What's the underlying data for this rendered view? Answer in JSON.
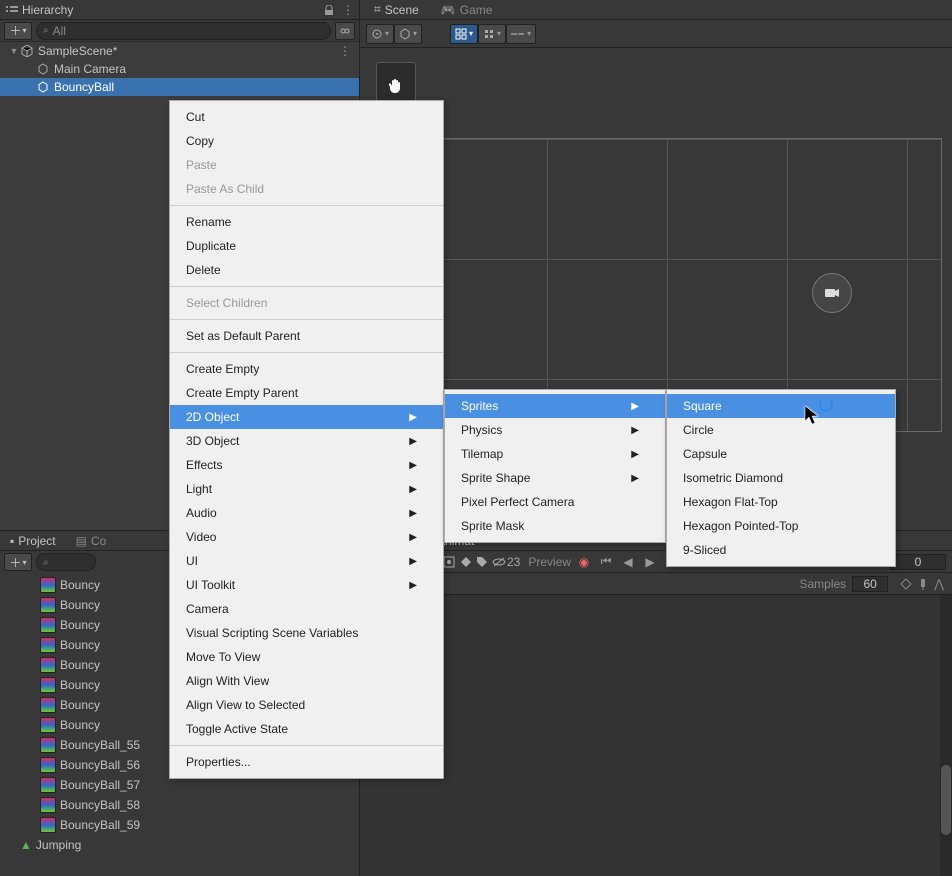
{
  "hierarchy": {
    "title": "Hierarchy",
    "search_placeholder": "All",
    "scene": "SampleScene*",
    "items": [
      "Main Camera",
      "BouncyBall"
    ]
  },
  "scene": {
    "tab_scene": "Scene",
    "tab_game": "Game"
  },
  "project": {
    "tab_project": "Project",
    "tab_console": "Co",
    "items": [
      "Bouncy",
      "Bouncy",
      "Bouncy",
      "Bouncy",
      "Bouncy",
      "Bouncy",
      "Bouncy",
      "Bouncy",
      "BouncyBall_55",
      "BouncyBall_56",
      "BouncyBall_57",
      "BouncyBall_58",
      "BouncyBall_59"
    ],
    "anim_clip": "Jumping"
  },
  "anim": {
    "tab": "Animat",
    "preview": "Preview",
    "frame": "0",
    "samples_label": "Samples",
    "samples_value": "60",
    "visibility_count": "23"
  },
  "menu": {
    "main": [
      {
        "label": "Cut"
      },
      {
        "label": "Copy"
      },
      {
        "label": "Paste",
        "disabled": true
      },
      {
        "label": "Paste As Child",
        "disabled": true
      },
      {
        "sep": true
      },
      {
        "label": "Rename"
      },
      {
        "label": "Duplicate"
      },
      {
        "label": "Delete"
      },
      {
        "sep": true
      },
      {
        "label": "Select Children",
        "disabled": true
      },
      {
        "sep": true
      },
      {
        "label": "Set as Default Parent"
      },
      {
        "sep": true
      },
      {
        "label": "Create Empty"
      },
      {
        "label": "Create Empty Parent"
      },
      {
        "label": "2D Object",
        "sub": true,
        "highlight": true
      },
      {
        "label": "3D Object",
        "sub": true
      },
      {
        "label": "Effects",
        "sub": true
      },
      {
        "label": "Light",
        "sub": true
      },
      {
        "label": "Audio",
        "sub": true
      },
      {
        "label": "Video",
        "sub": true
      },
      {
        "label": "UI",
        "sub": true
      },
      {
        "label": "UI Toolkit",
        "sub": true
      },
      {
        "label": "Camera"
      },
      {
        "label": "Visual Scripting Scene Variables"
      },
      {
        "label": "Move To View"
      },
      {
        "label": "Align With View"
      },
      {
        "label": "Align View to Selected"
      },
      {
        "label": "Toggle Active State"
      },
      {
        "sep": true
      },
      {
        "label": "Properties..."
      }
    ],
    "sub1": [
      {
        "label": "Sprites",
        "sub": true,
        "highlight": true
      },
      {
        "label": "Physics",
        "sub": true
      },
      {
        "label": "Tilemap",
        "sub": true
      },
      {
        "label": "Sprite Shape",
        "sub": true
      },
      {
        "label": "Pixel Perfect Camera"
      },
      {
        "label": "Sprite Mask"
      }
    ],
    "sub2": [
      {
        "label": "Square",
        "highlight": true
      },
      {
        "label": "Circle"
      },
      {
        "label": "Capsule"
      },
      {
        "label": "Isometric Diamond"
      },
      {
        "label": "Hexagon Flat-Top"
      },
      {
        "label": "Hexagon Pointed-Top"
      },
      {
        "label": "9-Sliced"
      }
    ]
  }
}
